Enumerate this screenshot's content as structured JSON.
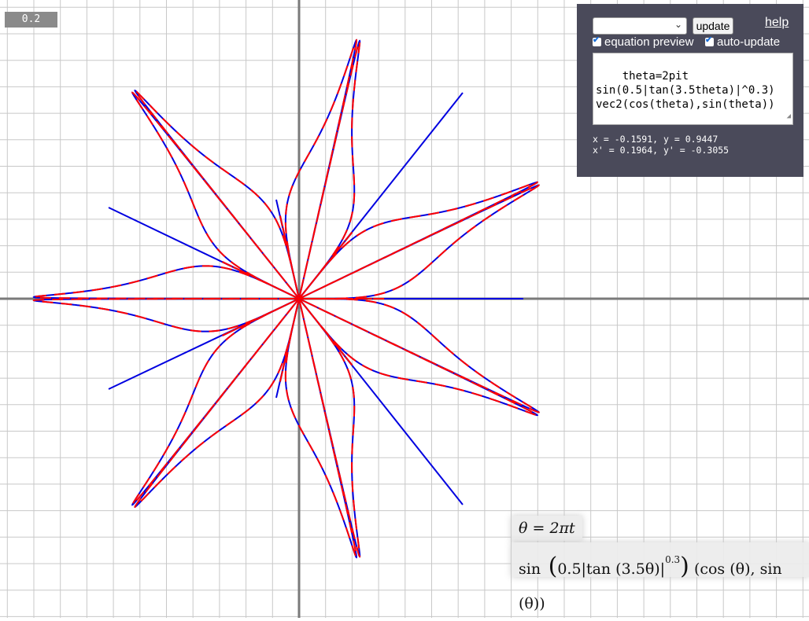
{
  "plot": {
    "scale_label": "0.2",
    "colors": {
      "grid": "#c8c8c8",
      "axis": "#7a7a7a",
      "red": "#ff0000",
      "blue": "#0000e0"
    }
  },
  "panel": {
    "select_value": "",
    "update_label": "update",
    "help_label": "help",
    "equation_preview_label": "equation preview",
    "auto_update_label": "auto-update",
    "equation_preview_checked": true,
    "auto_update_checked": true,
    "editor_text": "theta=2pit\nsin(0.5|tan(3.5theta)|^0.3)\nvec2(cos(theta),sin(theta))",
    "cursor_coords": "x = -0.1591, y = 0.9447",
    "cursor_coords_prime": "x' = 0.1964, y' = -0.3055"
  },
  "preview": {
    "line1": "θ = 2πt",
    "line2_prefix": "sin",
    "line2_inner": "0.5|tan (3.5θ)|",
    "line2_exponent": "0.3",
    "line2_suffix": "(cos (θ), sin (θ))"
  }
}
